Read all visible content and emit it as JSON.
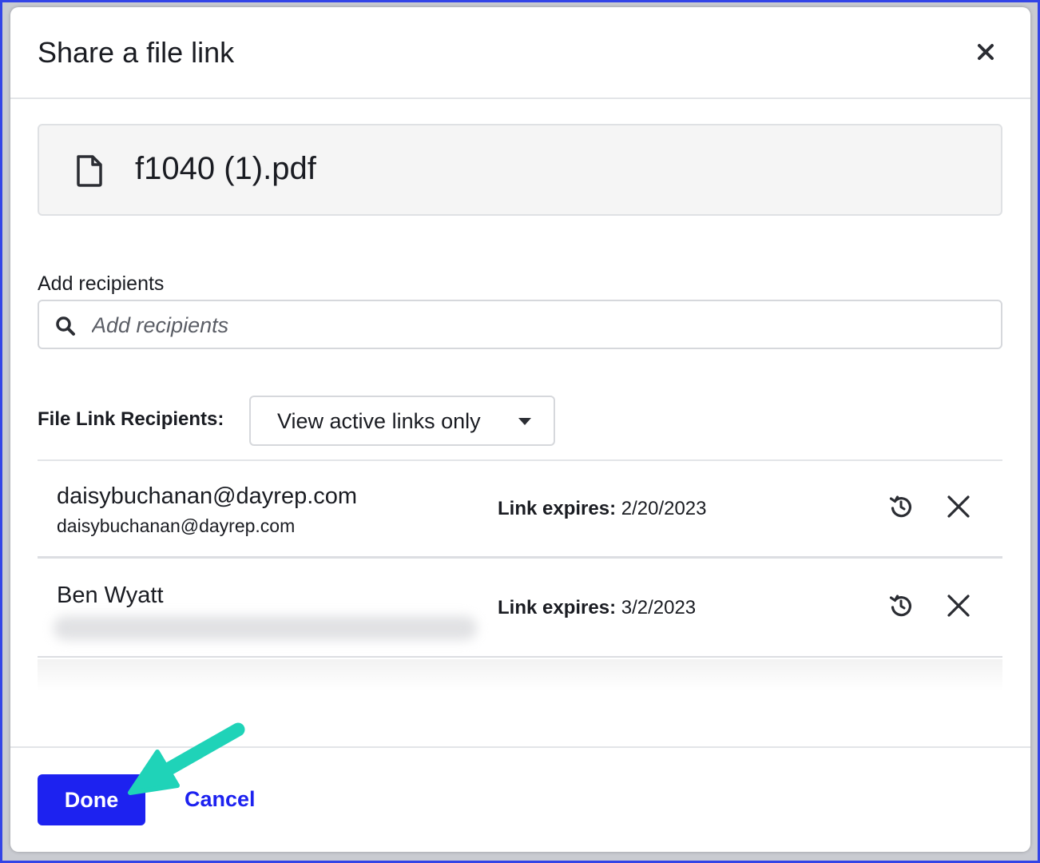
{
  "modal": {
    "title": "Share a file link",
    "close_icon": "close-icon"
  },
  "file": {
    "icon": "document-icon",
    "name": "f1040 (1).pdf"
  },
  "recipients_input": {
    "label": "Add recipients",
    "placeholder": "Add recipients",
    "icon": "search-icon"
  },
  "file_link_recipients": {
    "label": "File Link Recipients:",
    "filter": {
      "selected": "View active links only",
      "icon": "caret-down-icon"
    }
  },
  "recipients": [
    {
      "name": "daisybuchanan@dayrep.com",
      "email": "daisybuchanan@dayrep.com",
      "expires_label": "Link expires:",
      "expires_value": "2/20/2023"
    },
    {
      "name": "Ben Wyatt",
      "email_blurred": true,
      "expires_label": "Link expires:",
      "expires_value": "3/2/2023"
    }
  ],
  "row_actions": {
    "reset_icon": "history-icon",
    "remove_icon": "close-icon"
  },
  "footer": {
    "done_label": "Done",
    "cancel_label": "Cancel"
  },
  "colors": {
    "accent": "#1d22f0",
    "frame_border": "#3344e6",
    "annotation_arrow": "#1fd3b8"
  }
}
